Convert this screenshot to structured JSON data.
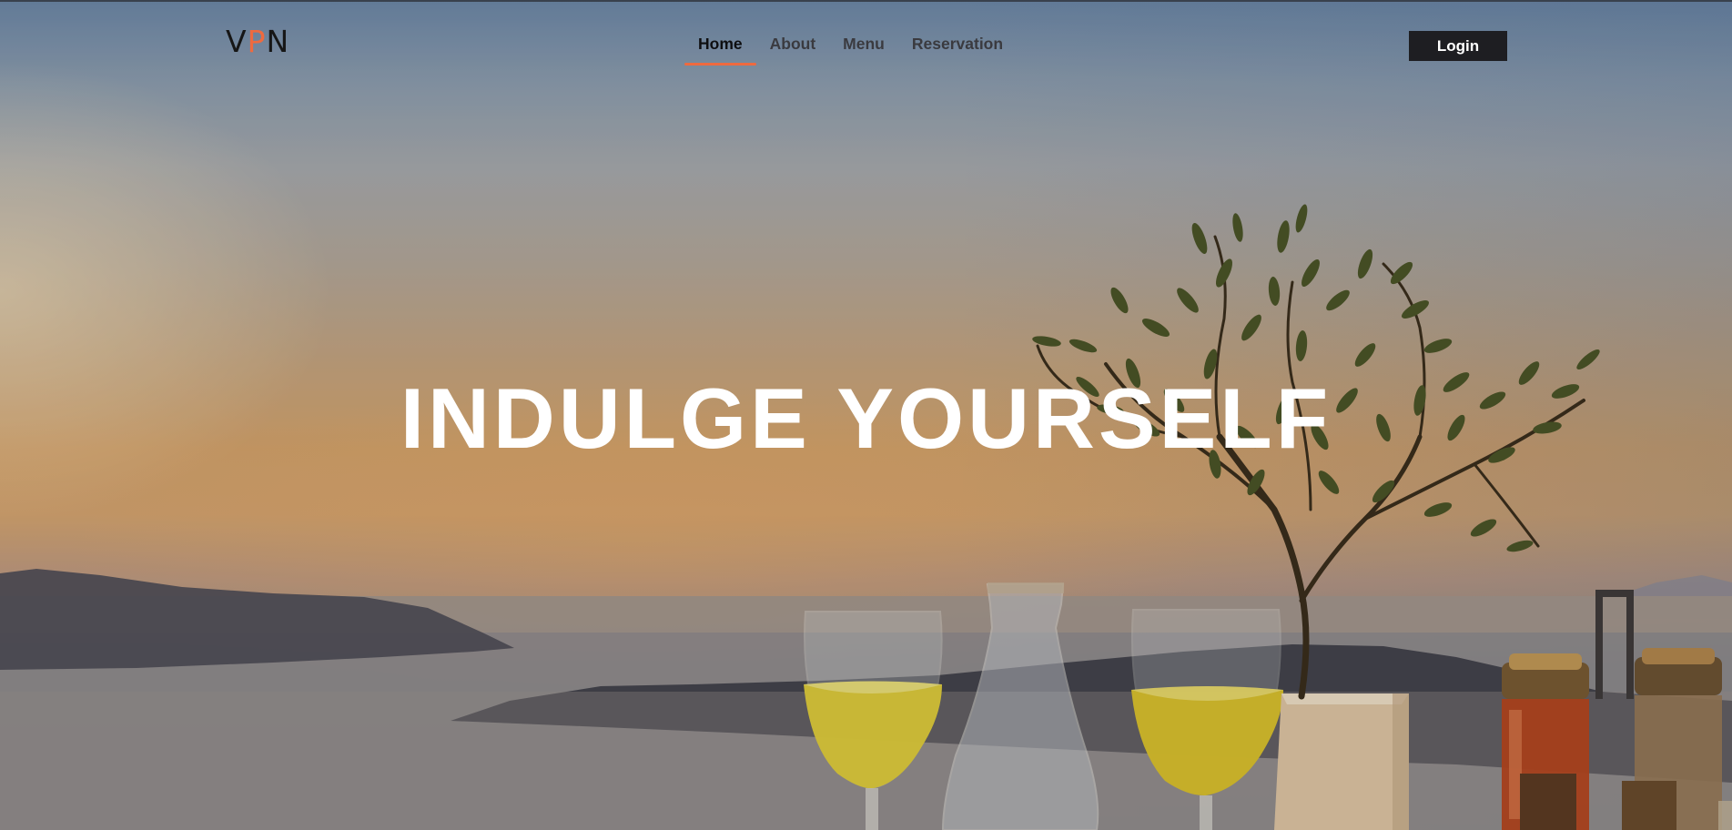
{
  "brand": {
    "logo_left": "V",
    "logo_accent": "P",
    "logo_right": "N",
    "accent_color": "#ee6a3f"
  },
  "nav": {
    "items": [
      {
        "label": "Home",
        "active": true
      },
      {
        "label": "About",
        "active": false
      },
      {
        "label": "Menu",
        "active": false
      },
      {
        "label": "Reservation",
        "active": false
      }
    ]
  },
  "header": {
    "login_label": "Login"
  },
  "hero": {
    "headline": "INDULGE YOURSELF",
    "image": "sunset-sea-table-wine-olive-tree"
  },
  "colors": {
    "text_dark": "#161616",
    "button_bg": "#1e1e22",
    "headline": "#ffffff"
  }
}
